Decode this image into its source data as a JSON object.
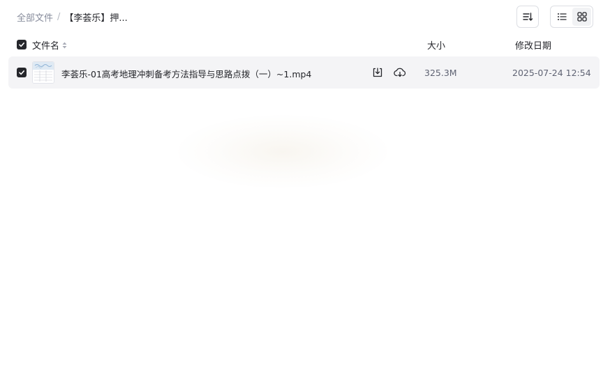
{
  "breadcrumb": {
    "root": "全部文件",
    "separator": "/",
    "current": "【李荟乐】押..."
  },
  "toolbar": {
    "sort_icon": "sort-list-icon",
    "view_list_icon": "list-view-icon",
    "view_grid_icon": "grid-view-icon"
  },
  "header": {
    "name": "文件名",
    "size": "大小",
    "date": "修改日期"
  },
  "files": [
    {
      "name": "李荟乐-01高考地理冲刺备考方法指导与思路点拨（一）~1.mp4",
      "size": "325.3M",
      "date": "2025-07-24 12:54",
      "checked": true,
      "actions": [
        "download-icon",
        "cloud-save-icon"
      ]
    }
  ],
  "colors": {
    "text_primary": "#25262b",
    "text_secondary": "#878c9c",
    "row_bg": "#f4f4f6",
    "checkbox": "#25262b"
  }
}
